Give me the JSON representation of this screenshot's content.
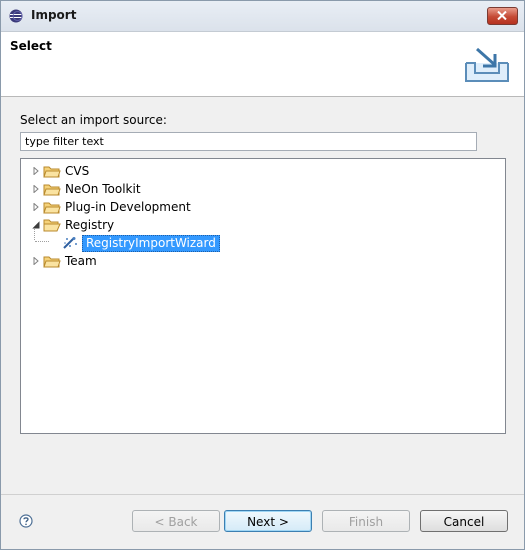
{
  "window": {
    "title": "Import"
  },
  "banner": {
    "title": "Select"
  },
  "source": {
    "label": "Select an import source:",
    "filter_placeholder": "type filter text",
    "filter_value": "type filter text"
  },
  "tree": {
    "items": [
      {
        "label": "CVS",
        "expanded": false,
        "icon": "folder-icon"
      },
      {
        "label": "NeOn Toolkit",
        "expanded": false,
        "icon": "folder-icon"
      },
      {
        "label": "Plug-in Development",
        "expanded": false,
        "icon": "folder-icon"
      },
      {
        "label": "Registry",
        "expanded": true,
        "icon": "open-folder-icon"
      },
      {
        "label": "RegistryImportWizard",
        "selected": true,
        "icon": "wizard-icon"
      },
      {
        "label": "Team",
        "expanded": false,
        "icon": "folder-icon"
      }
    ]
  },
  "buttons": {
    "back": "< Back",
    "next": "Next >",
    "finish": "Finish",
    "cancel": "Cancel"
  },
  "colors": {
    "selection": "#3399ff",
    "folder": "#e8b84a"
  }
}
